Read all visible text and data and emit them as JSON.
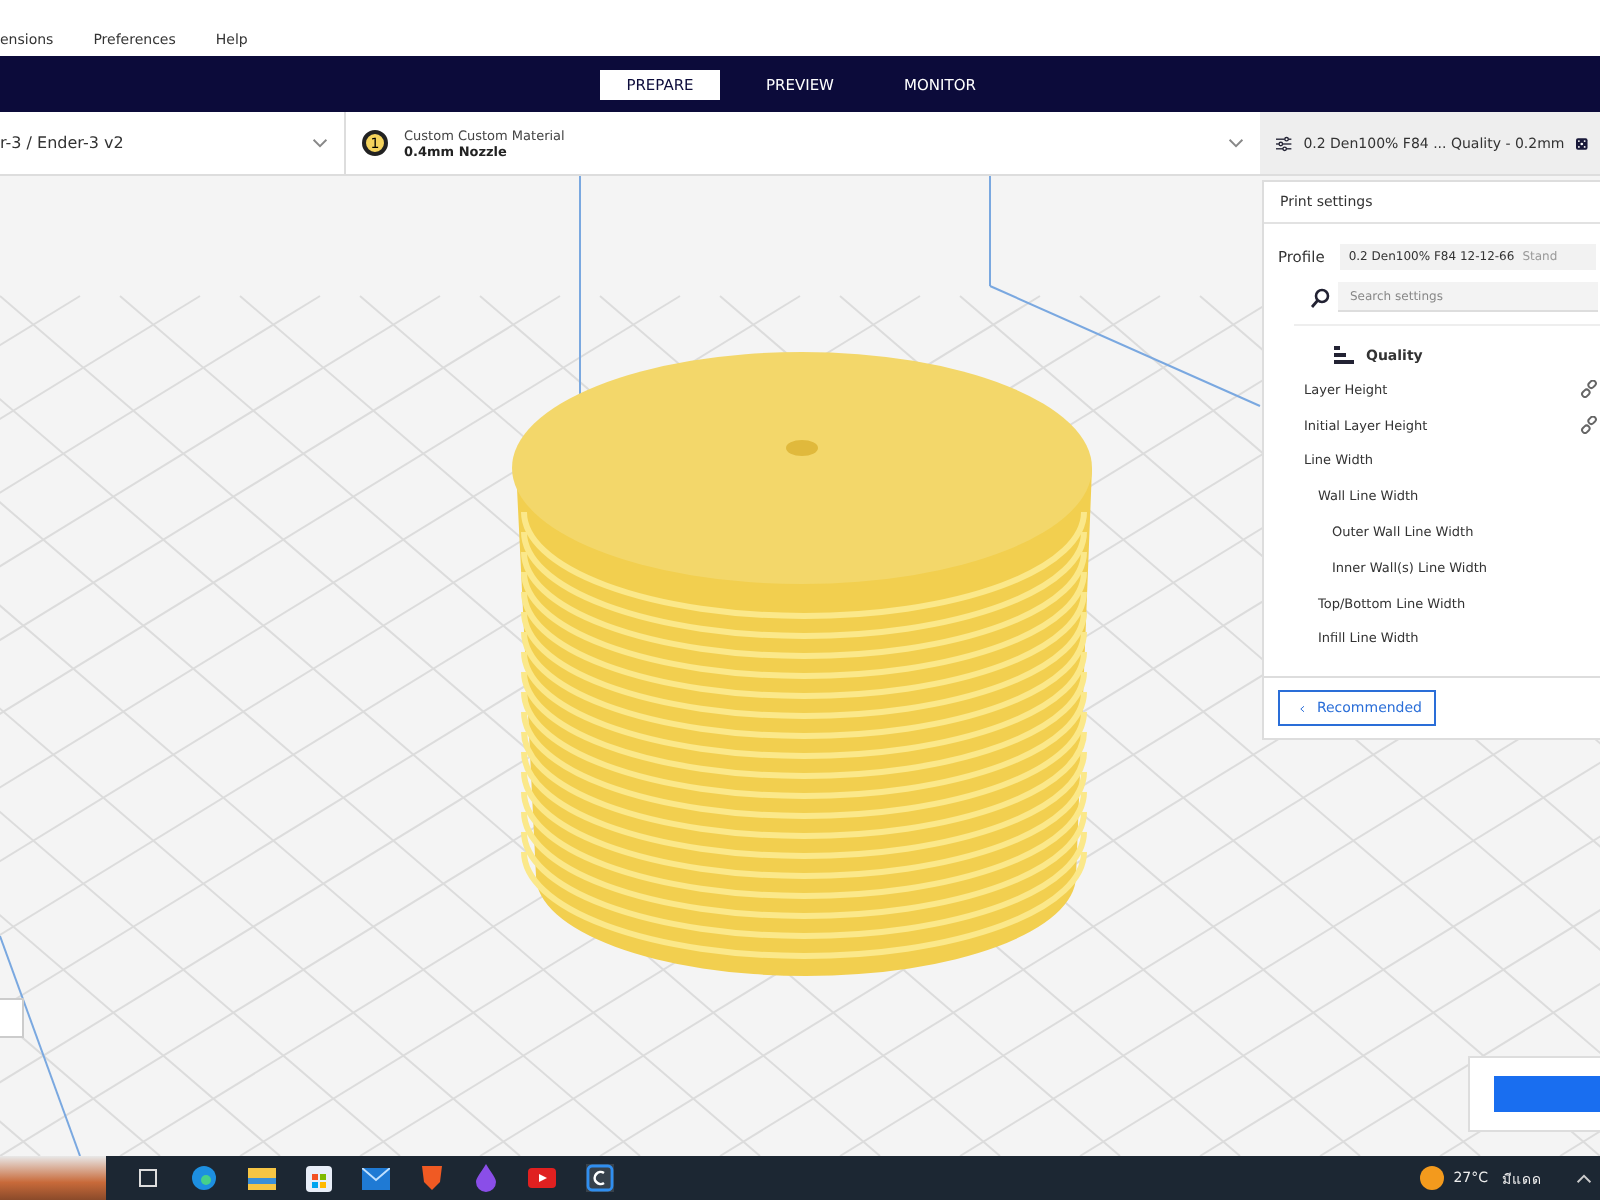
{
  "menu": [
    "ensions",
    "Preferences",
    "Help"
  ],
  "stages": [
    {
      "label": "PREPARE",
      "selected": true
    },
    {
      "label": "PREVIEW",
      "selected": false
    },
    {
      "label": "MONITOR",
      "selected": false
    }
  ],
  "printer": {
    "name": "r-3 / Ender-3 v2"
  },
  "material": {
    "number": "1",
    "name": "Custom Custom Material",
    "nozzle": "0.4mm Nozzle"
  },
  "profile_summary": "0.2 Den100% F84 ... Quality - 0.2mm",
  "print_settings": {
    "title": "Print settings",
    "profile_label": "Profile",
    "profile_value": "0.2 Den100% F84 12-12-66",
    "profile_hint": "Stand",
    "search": {
      "placeholder": "Search settings"
    },
    "category": "Quality",
    "settings": [
      {
        "label": "Layer Height",
        "linked": true
      },
      {
        "label": "Initial Layer Height",
        "linked": true
      },
      {
        "label": "Line Width",
        "linked": false,
        "children": [
          {
            "label": "Wall Line Width",
            "linked": false,
            "children": [
              {
                "label": "Outer Wall Line Width",
                "linked": false
              },
              {
                "label": "Inner Wall(s) Line Width",
                "linked": false
              }
            ]
          },
          {
            "label": "Top/Bottom Line Width",
            "linked": false
          },
          {
            "label": "Infill Line Width",
            "linked": false
          }
        ]
      }
    ],
    "back_button": "Recommended"
  },
  "taskbar": {
    "temperature": "27°C",
    "weather": "มีแดด"
  }
}
